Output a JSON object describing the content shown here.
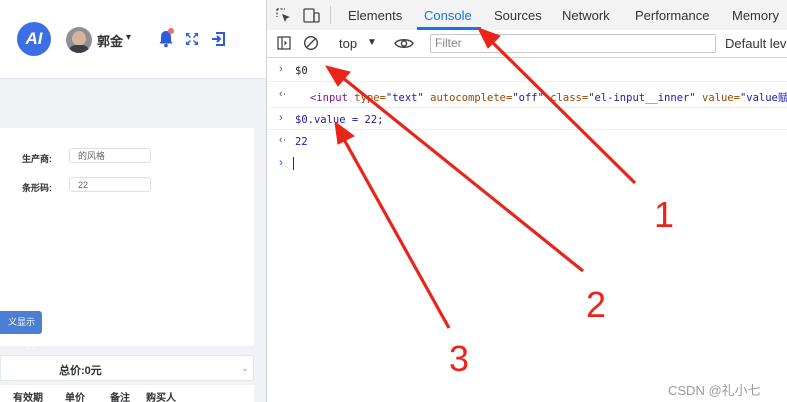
{
  "app": {
    "logo_text": "AI",
    "user_name": "郭金",
    "user_caret": "▾",
    "form": {
      "manufacturer_label": "生产商:",
      "manufacturer_value": "的风格",
      "barcode_label": "条形码:",
      "barcode_value": "22"
    },
    "display_columns_button": "义显示列",
    "total_price": "总价:0元",
    "total_chevron": "⌄",
    "table_headers": [
      "有效期",
      "单价",
      "备注",
      "购买人"
    ]
  },
  "devtools": {
    "tabs": [
      "Elements",
      "Console",
      "Sources",
      "Network",
      "Performance",
      "Memory"
    ],
    "active_tab": "Console",
    "context": "top",
    "context_caret": "▼",
    "filter_placeholder": "Filter",
    "levels": "Default levels",
    "console": {
      "line1_arrow": "›",
      "line1_input": "$0",
      "line2_arrow": "‹·",
      "line2_tag_open": "<input",
      "line2_attr_type": "type=",
      "line2_val_type": "\"text\"",
      "line2_attr_autocomplete": "autocomplete=",
      "line2_val_autocomplete": "\"off\"",
      "line2_attr_class": "class=",
      "line2_val_class": "\"el-input__inner\"",
      "line2_attr_value": "value=",
      "line2_val_value": "\"value赋值\">",
      "line3_arrow": "›",
      "line3_input": "$0.value = 22;",
      "line4_arrow": "‹·",
      "line4_output": "22",
      "prompt_arrow": "›"
    }
  },
  "annotations": {
    "arrow_colors": "#e8241b",
    "labels": [
      "1",
      "2",
      "3"
    ]
  },
  "watermark": "CSDN @礼小七"
}
